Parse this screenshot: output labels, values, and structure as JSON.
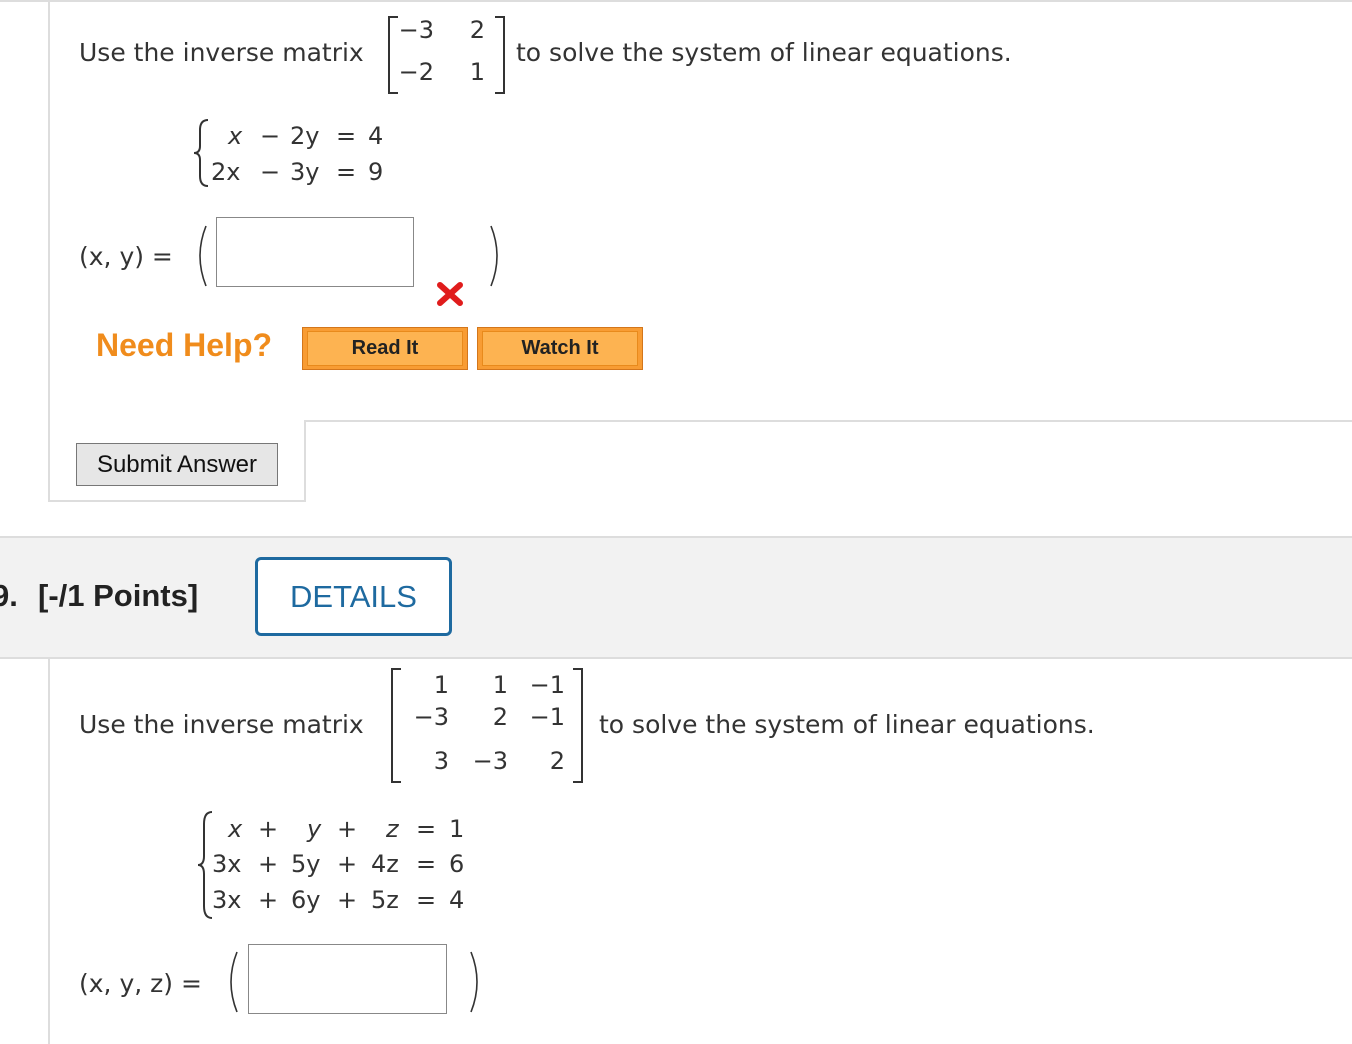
{
  "question1": {
    "intro_prefix": "Use the inverse matrix",
    "intro_suffix": "to solve the system of linear equations.",
    "matrix": [
      [
        "−3",
        "2"
      ],
      [
        "−2",
        "1"
      ]
    ],
    "equations": [
      {
        "t1": "x",
        "op1": "−",
        "t2": "2y",
        "eq": "=",
        "rhs": "4"
      },
      {
        "t1": "2x",
        "op1": "−",
        "t2": "3y",
        "eq": "=",
        "rhs": "9"
      }
    ],
    "answer_label": "(x, y) =",
    "answer_value": "",
    "status": "incorrect",
    "need_help": "Need Help?",
    "read_it": "Read It",
    "watch_it": "Watch It",
    "submit": "Submit Answer"
  },
  "question2": {
    "number_prefix": "9.",
    "points": "[-/1 Points]",
    "details": "DETAILS",
    "intro_prefix": "Use the inverse matrix",
    "intro_suffix": "to solve the system of linear equations.",
    "matrix": [
      [
        "1",
        "1",
        "−1"
      ],
      [
        "−3",
        "2",
        "−1"
      ],
      [
        "3",
        "−3",
        "2"
      ]
    ],
    "equations": [
      {
        "t1": "x",
        "op1": "+",
        "t2": "y",
        "op2": "+",
        "t3": "z",
        "eq": "=",
        "rhs": "1"
      },
      {
        "t1": "3x",
        "op1": "+",
        "t2": "5y",
        "op2": "+",
        "t3": "4z",
        "eq": "=",
        "rhs": "6"
      },
      {
        "t1": "3x",
        "op1": "+",
        "t2": "6y",
        "op2": "+",
        "t3": "5z",
        "eq": "=",
        "rhs": "4"
      }
    ],
    "answer_label": "(x, y, z) =",
    "answer_value": ""
  },
  "colors": {
    "need_help": "#f08c1c",
    "button_orange": "#f89c33",
    "details_blue": "#1e6aa0",
    "error_red": "#e01c1c",
    "header_bg": "#f2f2f2"
  }
}
